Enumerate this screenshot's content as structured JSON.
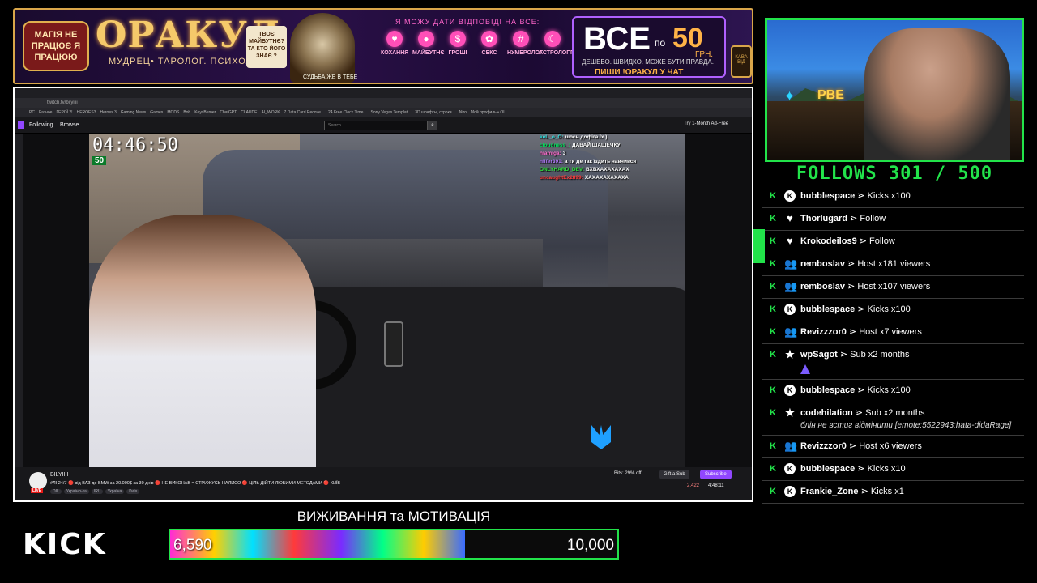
{
  "banner": {
    "magic_text": "МАГІЯ НЕ ПРАЦЮЄ Я ПРАЦЮЮ",
    "title": "ОРАКУЛ",
    "subtitle": "МУДРЕЦ• ТАРОЛОГ. ПСИХОЛОГ.",
    "future_card": "ТВОЄ МАЙБУТНЄ? ТА КТО ЙОГО ЗНАЄ ?",
    "wizard_caption": "СУДЬБА ЖЕ В ТЕБЕ",
    "answer_line": "Я МОЖУ ДАТИ ВІДПОВІДІ НА ВСЕ:",
    "categories": [
      {
        "icon": "heart-icon",
        "glyph": "♥",
        "label": "КОХАННЯ"
      },
      {
        "icon": "crystal-ball-icon",
        "glyph": "●",
        "label": "МАЙБУТНЄ"
      },
      {
        "icon": "money-icon",
        "glyph": "$",
        "label": "ГРОШІ"
      },
      {
        "icon": "lips-icon",
        "glyph": "✿",
        "label": "СЕКС"
      },
      {
        "icon": "numbers-icon",
        "glyph": "#",
        "label": "НУМЕРОЛОГ"
      },
      {
        "icon": "moon-icon",
        "glyph": "☾",
        "label": "АСТРОЛОГ"
      },
      {
        "icon": "brain-icon",
        "glyph": "☼",
        "label": "ПСИХОЛОГ"
      }
    ],
    "price_big": "ВСЕ",
    "price_from": "по",
    "price_amount": "50",
    "price_unit": "ГРН.",
    "price_tagline": "ДЕШЕВО. ШВИДКО. МОЖЕ БУТИ ПРАВДА.",
    "price_cta": "ПИШИ !ОРАКУЛ У ЧАТ",
    "mug_text": "КАВА ВІД"
  },
  "browser": {
    "url": "twitch.tv/bilyiiii",
    "bookmarks": [
      "PC",
      "Разное",
      "ГЕРОЇ 2!",
      "HEROES3",
      "Heroes 3",
      "Gaming News",
      "Games",
      "MODS",
      "Bob",
      "KeysBurner",
      "ChatGPT",
      "CLAUDE",
      "AI_WORK",
      "7 Data Card Recove...",
      "24 Free Clock Time...",
      "Sony Vegas Templat...",
      "3D шрифты, строки...",
      "Niro",
      "Мой профиль • OL..."
    ],
    "nav_following": "Following",
    "nav_browse": "Browse",
    "search_placeholder": "Search",
    "ad_free": "Try 1-Month Ad-Free"
  },
  "video": {
    "timer": "04:46:50",
    "timer_badge": "50"
  },
  "overlay_chat": [
    {
      "user": "keL_o_O:",
      "text": "шось дофіга їх )",
      "color": "#2ee6e6"
    },
    {
      "user": "cloudness_:",
      "text": "ДАВАЙ ШАШЕЧКУ",
      "color": "#00e05a"
    },
    {
      "user": "niamiga:",
      "text": "3",
      "color": "#ff70d0"
    },
    {
      "user": "nilfer391:",
      "text": "а ти де так їздить навчився",
      "color": "#b57aff"
    },
    {
      "user": "ONLYHARD_DEV:",
      "text": "ВХВХАХАХАХАХ",
      "color": "#2ee03a"
    },
    {
      "user": "uncaughtEx2899:",
      "text": "ХАХАХАХАХАХА",
      "color": "#ff3b3b"
    }
  ],
  "stream_info": {
    "channel": "BILYIIII",
    "title": "#ЛІ 24/7 🔴 від ВАЗ до BMW за 20.000$ за 30 днів 🔴 НЕ ВИКОНАВ = СТРИЖУСЬ НАЛИСО 🔴 ЦІЛЬ ДІЙТИ ЛЮБИМИ МЕТОДАМИ 🔴 КИЇВ",
    "live": "LIVE",
    "tags": [
      "DIL",
      "Українська",
      "IRL",
      "Україна",
      "Київ"
    ],
    "bits": "Bits: 29% off",
    "gift": "Gift a Sub",
    "subscribe": "Subscribe",
    "viewers": "2,422",
    "uptime": "4:48:11"
  },
  "webcam": {
    "sign_text": "РВЕ"
  },
  "follows": {
    "label": "FOLLOWS 301 / 500",
    "current": 301,
    "goal": 500
  },
  "events": [
    {
      "icon": "kick-coin-icon",
      "glyph": "K",
      "user": "bubblespace",
      "action": "⋗ Kicks x100"
    },
    {
      "icon": "heart-icon",
      "glyph": "♥",
      "user": "Thorlugard",
      "action": "⋗ Follow"
    },
    {
      "icon": "heart-icon",
      "glyph": "♥",
      "user": "Krokodeilos9",
      "action": "⋗ Follow",
      "active": true
    },
    {
      "icon": "people-icon",
      "glyph": "👥",
      "user": "remboslav",
      "action": "⋗ Host x181 viewers"
    },
    {
      "icon": "people-icon",
      "glyph": "👥",
      "user": "remboslav",
      "action": "⋗ Host x107 viewers"
    },
    {
      "icon": "kick-coin-icon",
      "glyph": "K",
      "user": "bubblespace",
      "action": "⋗ Kicks x100"
    },
    {
      "icon": "people-icon",
      "glyph": "👥",
      "user": "Revizzzor0",
      "action": "⋗ Host x7 viewers"
    },
    {
      "icon": "star-icon",
      "glyph": "★",
      "user": "wpSagot",
      "action": "⋗ Sub x2 months",
      "emote": true
    },
    {
      "icon": "kick-coin-icon",
      "glyph": "K",
      "user": "bubblespace",
      "action": "⋗ Kicks x100"
    },
    {
      "icon": "star-icon",
      "glyph": "★",
      "user": "codehilation",
      "action": "⋗ Sub x2 months",
      "message": "блін не встиг відмінити [emote:5522943:hata-didaRage]"
    },
    {
      "icon": "people-icon",
      "glyph": "👥",
      "user": "Revizzzor0",
      "action": "⋗ Host x6 viewers"
    },
    {
      "icon": "kick-coin-icon",
      "glyph": "K",
      "user": "bubblespace",
      "action": "⋗ Kicks x10"
    },
    {
      "icon": "kick-coin-icon",
      "glyph": "K",
      "user": "Frankie_Zone",
      "action": "⋗ Kicks x1"
    }
  ],
  "bottom": {
    "logo": "KICK",
    "goal_title": "ВИЖИВАННЯ та МОТИВАЦІЯ",
    "goal_current": "6,590",
    "goal_target": "10,000",
    "goal_fraction": 0.659
  },
  "colors": {
    "accent_green": "#22e34a",
    "twitch_purple": "#9147ff",
    "banner_gold": "#d9a64a"
  }
}
